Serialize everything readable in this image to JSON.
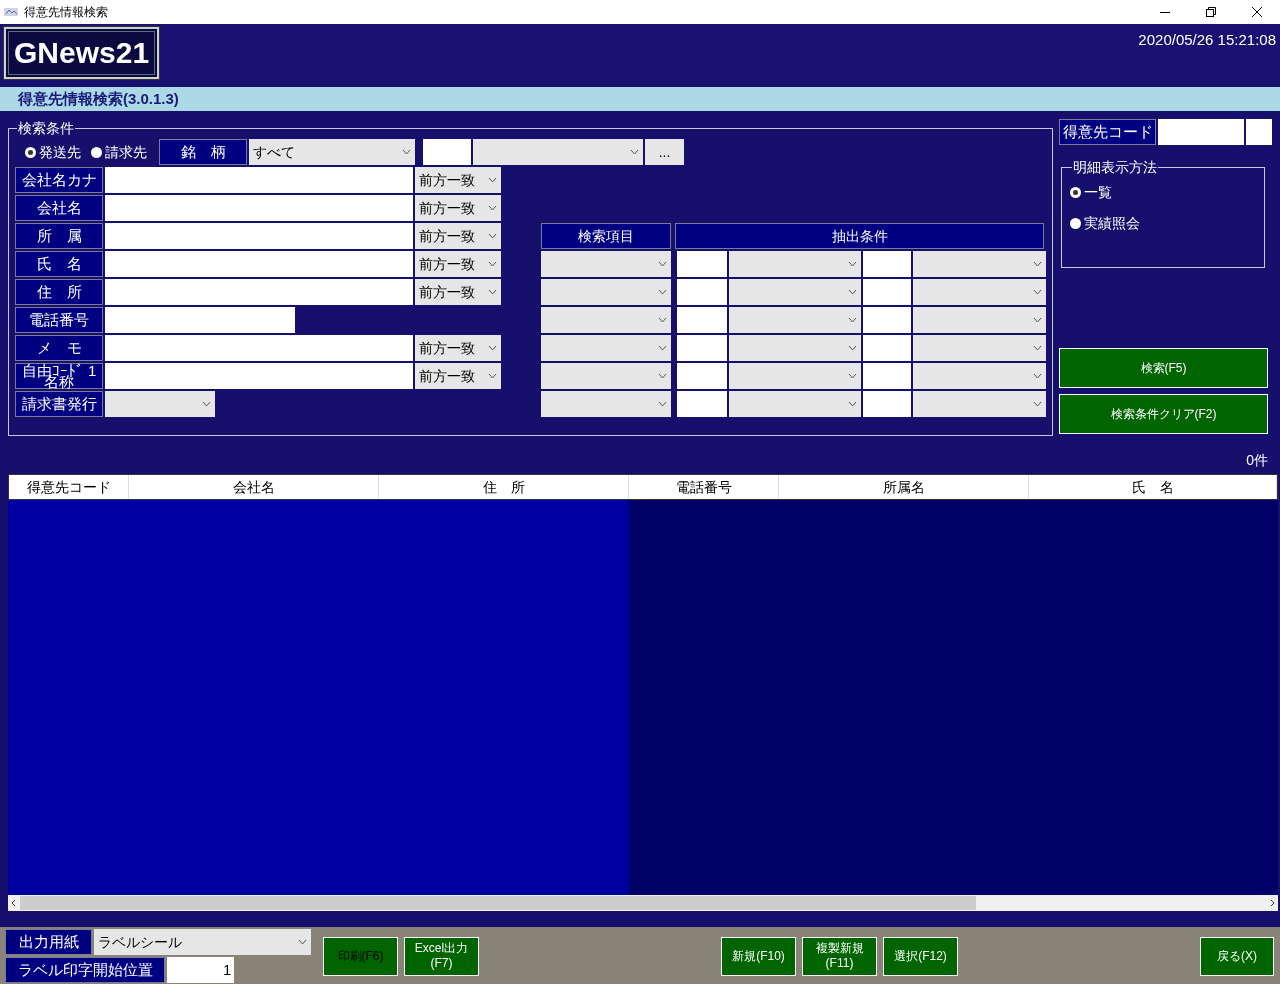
{
  "window": {
    "title": "得意先情報検索"
  },
  "header": {
    "logo": "GNews21",
    "datetime": "2020/05/26 15:21:08"
  },
  "subtitle": "得意先情報検索(3.0.1.3)",
  "search": {
    "legend": "検索条件",
    "targets": [
      {
        "label": "発送先",
        "selected": true
      },
      {
        "label": "請求先",
        "selected": false
      }
    ],
    "brand": {
      "label": "銘　柄",
      "value": "すべて"
    },
    "ellipsis": "...",
    "fields": [
      {
        "label": "会社名カナ",
        "kind": "text",
        "match": "前方一致"
      },
      {
        "label": "会社名",
        "kind": "text",
        "match": "前方一致"
      },
      {
        "label": "所　属",
        "kind": "text",
        "match": "前方一致"
      },
      {
        "label": "氏　名",
        "kind": "text",
        "match": "前方一致"
      },
      {
        "label": "住　所",
        "kind": "text",
        "match": "前方一致"
      },
      {
        "label": "電話番号",
        "kind": "short"
      },
      {
        "label": "メ　モ",
        "kind": "text",
        "match": "前方一致"
      },
      {
        "label": "自由ｺｰﾄﾞ 1 名称",
        "kind": "text",
        "match": "前方一致"
      },
      {
        "label": "請求書発行",
        "kind": "select"
      }
    ],
    "extract": {
      "item_header": "検索項目",
      "condition_header": "抽出条件",
      "rows": [
        {
          "kind": "condition"
        },
        {
          "kind": "condition"
        },
        {
          "kind": "condition"
        },
        {
          "kind": "condition"
        },
        {
          "kind": "condition"
        },
        {
          "kind": "condition"
        }
      ]
    }
  },
  "side": {
    "code_label": "得意先コード",
    "display": {
      "legend": "明細表示方法",
      "options": [
        {
          "label": "一覧",
          "selected": true
        },
        {
          "label": "実績照会",
          "selected": false
        }
      ]
    },
    "buttons": [
      "検索(F5)",
      "検索条件クリア(F2)"
    ]
  },
  "results": {
    "count": "0件",
    "columns": [
      "得意先コード",
      "会社名",
      "住　所",
      "電話番号",
      "所属名",
      "氏　名"
    ]
  },
  "footer": {
    "paper_label": "出力用紙",
    "paper_value": "ラベルシール",
    "start_label": "ラベル印字開始位置",
    "start_value": "1",
    "buttons": [
      {
        "label": "印刷(F6)",
        "disabled": true
      },
      {
        "label": "Excel出力\n(F7)",
        "disabled": false
      },
      {
        "kind": "gap"
      },
      {
        "label": "新規(F10)",
        "disabled": false
      },
      {
        "label": "複製新規\n(F11)",
        "disabled": false
      },
      {
        "label": "選択(F12)",
        "disabled": false
      },
      {
        "kind": "gap"
      },
      {
        "label": "戻る(X)",
        "disabled": false
      }
    ]
  }
}
